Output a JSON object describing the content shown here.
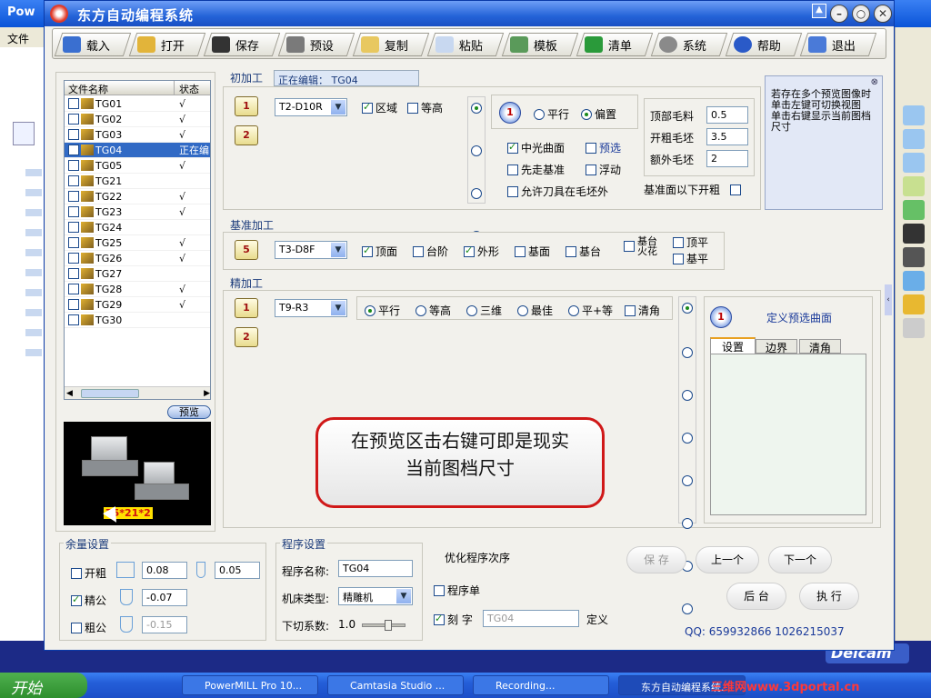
{
  "background_app": {
    "title": "Pow",
    "menu": "文件",
    "brand": "Delcam"
  },
  "dialog": {
    "title": "东方自动编程系统"
  },
  "toolbar": [
    {
      "label": "载入",
      "icon": "load-icon"
    },
    {
      "label": "打开",
      "icon": "open-icon"
    },
    {
      "label": "保存",
      "icon": "save-icon"
    },
    {
      "label": "预设",
      "icon": "preset-icon"
    },
    {
      "label": "复制",
      "icon": "copy-icon"
    },
    {
      "label": "粘贴",
      "icon": "paste-icon"
    },
    {
      "label": "模板",
      "icon": "template-icon"
    },
    {
      "label": "清单",
      "icon": "list-icon"
    },
    {
      "label": "系统",
      "icon": "system-icon"
    },
    {
      "label": "帮助",
      "icon": "help-icon"
    },
    {
      "label": "退出",
      "icon": "exit-icon"
    }
  ],
  "file_list": {
    "col_name": "文件名称",
    "col_status": "状态",
    "rows": [
      {
        "name": "TG01",
        "status": "√"
      },
      {
        "name": "TG02",
        "status": "√"
      },
      {
        "name": "TG03",
        "status": "√"
      },
      {
        "name": "TG04",
        "status": "正在编"
      },
      {
        "name": "TG05",
        "status": "√"
      },
      {
        "name": "TG21",
        "status": ""
      },
      {
        "name": "TG22",
        "status": "√"
      },
      {
        "name": "TG23",
        "status": "√"
      },
      {
        "name": "TG24",
        "status": ""
      },
      {
        "name": "TG25",
        "status": "√"
      },
      {
        "name": "TG26",
        "status": "√"
      },
      {
        "name": "TG27",
        "status": ""
      },
      {
        "name": "TG28",
        "status": "√"
      },
      {
        "name": "TG29",
        "status": "√"
      },
      {
        "name": "TG30",
        "status": ""
      }
    ],
    "preview_button": "预览",
    "preview_dims": "75*21*2"
  },
  "rough": {
    "label": "初加工",
    "editing_label": "正在编辑：",
    "editing_value": "TG04",
    "tool": "T2-D10R",
    "chk_area": "区域",
    "chk_contour": "等高",
    "radio_parallel": "平行",
    "radio_offset": "偏置",
    "chk_center": "中光曲面",
    "chk_preselect": "预选",
    "chk_base_first": "先走基准",
    "chk_float": "浮动",
    "chk_allow_out": "允许刀具在毛坯外",
    "top_stock_label": "顶部毛料",
    "top_stock_value": "0.5",
    "rough_stock_label": "开粗毛坯",
    "rough_stock_value": "3.5",
    "extra_stock_label": "额外毛坯",
    "extra_stock_value": "2",
    "below_base_label": "基准面以下开粗"
  },
  "hint": {
    "text": "若存在多个预览图像时单击左键可切换视图\n单击右键显示当前图档尺寸"
  },
  "base": {
    "label": "基准加工",
    "tool": "T3-D8F",
    "chk_top": "顶面",
    "chk_step": "台阶",
    "chk_outline": "外形",
    "chk_basesurf": "基面",
    "chk_basestep": "基台",
    "chk_base_fire": "基台\n火花",
    "chk_top_flat": "顶平",
    "chk_base_flat": "基平"
  },
  "finish": {
    "label": "精加工",
    "tool": "T9-R3",
    "radios": [
      "平行",
      "等高",
      "三维",
      "最佳",
      "平+等"
    ],
    "chk_clear_corner": "清角",
    "define_preselect": "定义预选曲面",
    "tabs": [
      "设置",
      "边界",
      "清角"
    ]
  },
  "callout": {
    "line1": "在预览区击右键可即是现实",
    "line2": "当前图档尺寸"
  },
  "allowance": {
    "label": "余量设置",
    "rough_label": "开粗",
    "rough_v1": "0.08",
    "rough_v2": "0.05",
    "fine_label": "精公",
    "fine_v": "-0.07",
    "coarse_label": "粗公",
    "coarse_v": "-0.15"
  },
  "program": {
    "label": "程序设置",
    "name_label": "程序名称:",
    "name_value": "TG04",
    "machine_label": "机床类型:",
    "machine_value": "精雕机",
    "feed_label": "下切系数:",
    "feed_value": "1.0",
    "feed_level": 0.6
  },
  "optimize": {
    "label": "优化程序次序",
    "chk_prog_list": "程序单",
    "chk_engrave": "刻  字",
    "engrave_value": "TG04",
    "define": "定义"
  },
  "actions": {
    "save": "保 存",
    "prev": "上一个",
    "next": "下一个",
    "background": "后 台",
    "execute": "执 行"
  },
  "qq": "QQ: 659932866  1026215037",
  "taskbar": {
    "start": "开始",
    "tasks": [
      "PowerMILL Pro 10...",
      "Camtasia Studio ...",
      "Recording...",
      "东方自动编程系统..."
    ],
    "watermark": "三维网www.3dportal.cn"
  }
}
